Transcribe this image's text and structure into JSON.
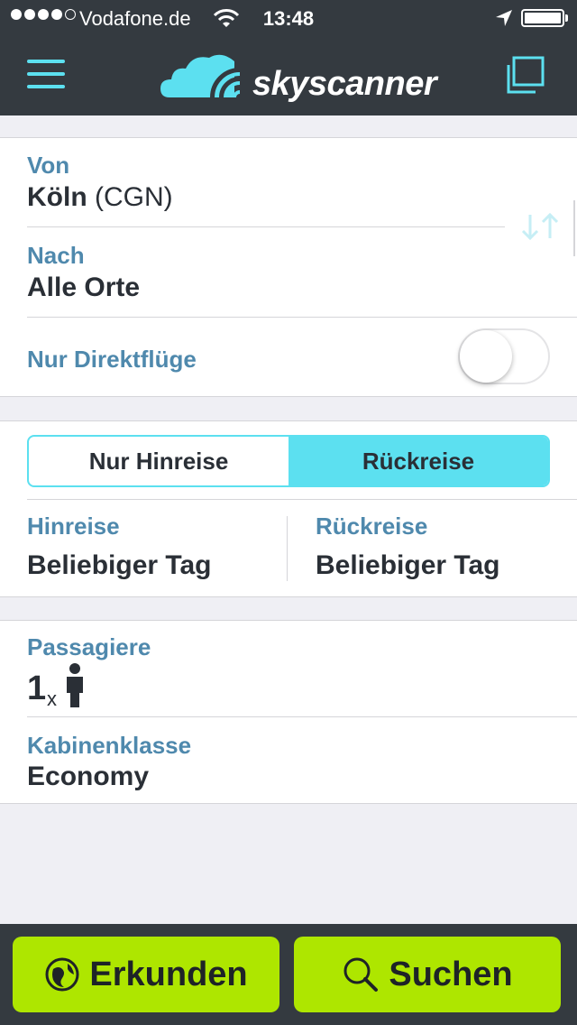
{
  "status_bar": {
    "carrier": "Vodafone.de",
    "time": "13:48"
  },
  "header": {
    "logo_text": "skyscanner",
    "icons": [
      "menu-icon",
      "copy-icon"
    ]
  },
  "route": {
    "from_label": "Von",
    "from_city": "Köln",
    "from_code": "(CGN)",
    "to_label": "Nach",
    "to_value": "Alle Orte",
    "direct_label": "Nur Direktflüge",
    "direct_enabled": false
  },
  "trip": {
    "tabs": [
      {
        "label": "Nur Hinreise",
        "active": false
      },
      {
        "label": "Rückreise",
        "active": true
      }
    ],
    "outbound_label": "Hinreise",
    "outbound_value": "Beliebiger Tag",
    "return_label": "Rückreise",
    "return_value": "Beliebiger Tag"
  },
  "passengers": {
    "label": "Passagiere",
    "count": "1",
    "times": "x",
    "cabin_label": "Kabinenklasse",
    "cabin_value": "Economy"
  },
  "actions": {
    "explore_label": "Erkunden",
    "search_label": "Suchen"
  },
  "colors": {
    "accent": "#5ce0f0",
    "label": "#4f89ad",
    "action": "#aee600",
    "header_bg": "#343a40"
  }
}
